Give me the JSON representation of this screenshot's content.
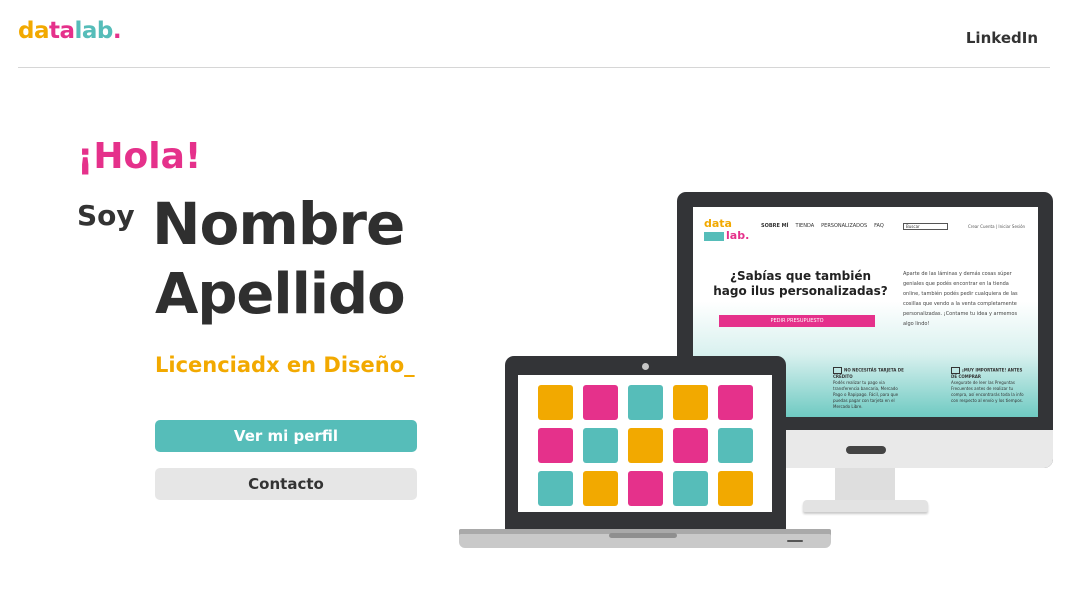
{
  "header": {
    "logo_parts": [
      {
        "text": "da",
        "color": "#f2a900"
      },
      {
        "text": "ta",
        "color": "#e5318b"
      },
      {
        "text": "lab",
        "color": "#56bdb9"
      },
      {
        "text": ".",
        "color": "#e5318b"
      }
    ],
    "nav_link": "LinkedIn"
  },
  "hero": {
    "greeting": "¡Hola!",
    "intro": "Soy",
    "first_name": "Nombre",
    "last_name": "Apellido",
    "role": "Licenciadx en Diseño_",
    "primary_button": "Ver mi perfil",
    "secondary_button": "Contacto"
  },
  "monitor_mockup": {
    "logo_line1": "data",
    "logo_line2": "lab.",
    "nav": [
      "SOBRE MÍ",
      "TIENDA",
      "PERSONALIZADOS",
      "FAQ"
    ],
    "search_placeholder": "Buscar",
    "right_text": "Crear Cuenta | Iniciar Sesión",
    "heading": "¿Sabías que también hago ilus personalizadas?",
    "button": "PEDIR PRESUPUESTO",
    "paragraph": "Aparte de las láminas y demás cosas súper geniales que podés encontrar en la tienda online, también podés pedir cualquiera de las cosillas que vendo a la venta completamente personalizadas. ¡Contame tu idea y armemos algo lindo!",
    "feature1_title": "NO NECESITÁS TARJETA DE CRÉDITO",
    "feature1_text": "Podés realizar tu pago via transferencia bancaria, Mercado Pago o Rapipago. Fácil, para que puedas pagar con tarjeta en el Mercado Libre.",
    "feature2_title": "¡MUY IMPORTANTE! ANTES DE COMPRAR",
    "feature2_text": "Asegurate de leer las Preguntas Frecuentes antes de realizar tu compra, así encontrarás toda la info con respecto al envío y los tiempos."
  },
  "laptop_mockup": {
    "tile_colors": [
      "#f2a900",
      "#e5318b",
      "#56bdb9",
      "#f2a900",
      "#e5318b",
      "#e5318b",
      "#56bdb9",
      "#f2a900",
      "#e5318b",
      "#56bdb9",
      "#56bdb9",
      "#f2a900",
      "#e5318b",
      "#56bdb9",
      "#f2a900"
    ]
  },
  "colors": {
    "pink": "#e5318b",
    "yellow": "#f2a900",
    "teal": "#56bdb9",
    "dark": "#2f2f2f"
  }
}
